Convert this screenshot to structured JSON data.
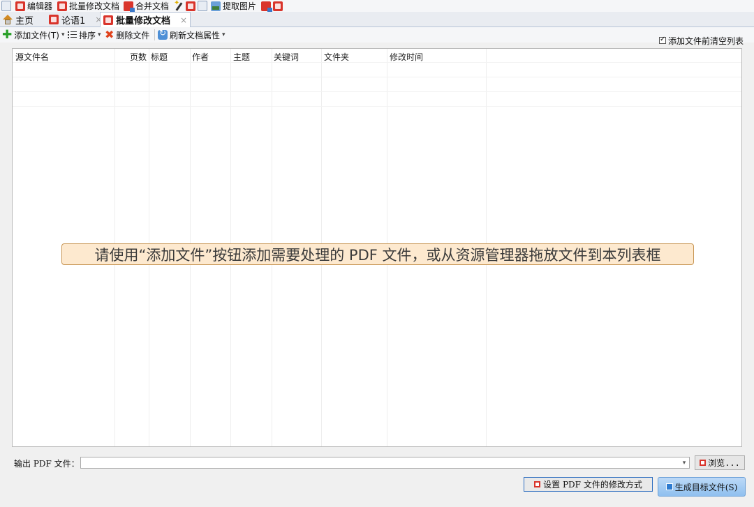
{
  "toolbar": {
    "items": [
      {
        "label": "编辑器",
        "icon": "pdf-edit-icon"
      },
      {
        "label": "批量修改文档",
        "icon": "pdf-batch-icon"
      },
      {
        "label": "合并文档",
        "icon": "merge-icon"
      },
      {
        "label": "提取图片",
        "icon": "extract-image-icon"
      }
    ]
  },
  "tabs": [
    {
      "label": "主页",
      "icon": "home-icon"
    },
    {
      "label": "论语1",
      "icon": "pdf-edit-icon",
      "close": "×"
    },
    {
      "label": "批量修改文档",
      "icon": "pdf-edit-icon",
      "close": "×",
      "active": true
    }
  ],
  "actions": {
    "add_files": "添加文件(T)",
    "sort": "排序",
    "delete_file": "删除文件",
    "refresh_props": "刷新文档属性",
    "clear_before_add": "添加文件前清空列表",
    "clear_before_add_checked": true
  },
  "grid": {
    "columns": [
      "源文件名",
      "页数",
      "标题",
      "作者",
      "主题",
      "关键词",
      "文件夹",
      "修改时间"
    ],
    "empty_hint": "请使用“添加文件”按钮添加需要处理的 PDF 文件，或从资源管理器拖放文件到本列表框"
  },
  "output": {
    "label": "输出 PDF 文件：",
    "value": "",
    "browse": "浏览..."
  },
  "buttons": {
    "set_mode": "设置 PDF 文件的修改方式",
    "generate": "生成目标文件(S)"
  },
  "colors": {
    "accent": "#2f6fc0",
    "hint_bg": "#fde9cf",
    "hint_border": "#c89654",
    "generate_bg": "#a9cdf3"
  }
}
